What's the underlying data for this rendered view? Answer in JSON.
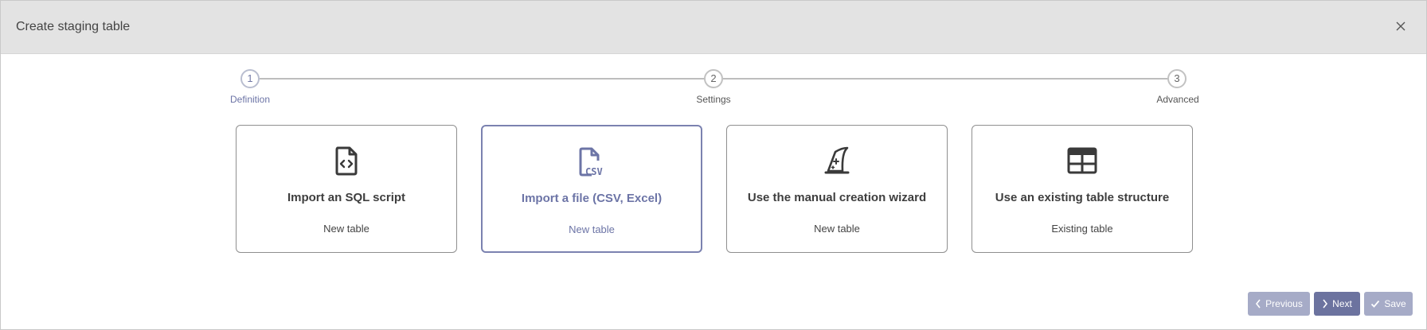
{
  "dialog": {
    "title": "Create staging table"
  },
  "stepper": {
    "steps": [
      {
        "number": "1",
        "label": "Definition"
      },
      {
        "number": "2",
        "label": "Settings"
      },
      {
        "number": "3",
        "label": "Advanced"
      }
    ]
  },
  "options": [
    {
      "title": "Import an SQL script",
      "subtitle": "New table",
      "icon": "file-code-icon"
    },
    {
      "title": "Import a file (CSV, Excel)",
      "subtitle": "New table",
      "icon": "csv-file-icon"
    },
    {
      "title": "Use the manual creation wizard",
      "subtitle": "New table",
      "icon": "wizard-hat-icon"
    },
    {
      "title": "Use an existing table structure",
      "subtitle": "Existing table",
      "icon": "table-icon"
    }
  ],
  "footer": {
    "previous_label": "Previous",
    "next_label": "Next",
    "save_label": "Save"
  },
  "colors": {
    "accent": "#6c739f",
    "accent_light": "#a6abc7",
    "header_bg": "#e3e3e3"
  }
}
